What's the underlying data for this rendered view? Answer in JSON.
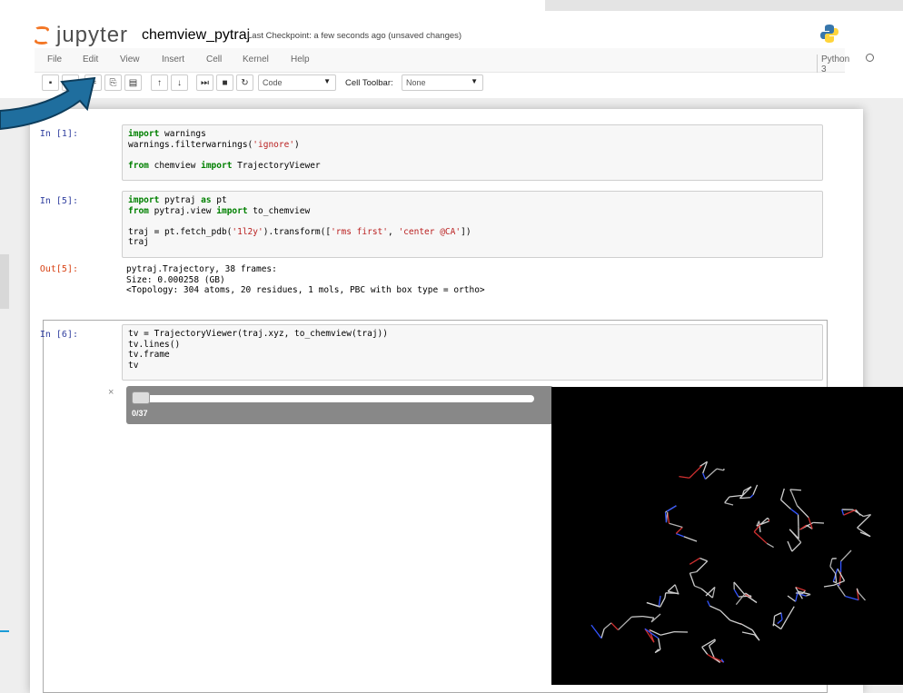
{
  "app": {
    "logo_text": "jupyter",
    "notebook_name": "chemview_pytraj",
    "checkpoint": "Last Checkpoint: a few seconds ago (unsaved changes)",
    "kernel_name": "Python 3"
  },
  "menu": [
    "File",
    "Edit",
    "View",
    "Insert",
    "Cell",
    "Kernel",
    "Help"
  ],
  "toolbar": {
    "cell_type": "Code",
    "cell_toolbar_label": "Cell Toolbar:",
    "cell_toolbar_value": "None",
    "buttons": [
      "save-icon",
      "add-icon",
      "cut-icon",
      "copy-icon",
      "paste-icon",
      "move-up-icon",
      "move-down-icon",
      "run-icon",
      "stop-icon",
      "restart-icon"
    ]
  },
  "cells": [
    {
      "prompt": "In [1]:",
      "lines": [
        [
          {
            "t": "import",
            "k": "kw"
          },
          {
            "t": " warnings"
          }
        ],
        [
          {
            "t": "warnings.filterwarnings("
          },
          {
            "t": "'ignore'",
            "k": "st"
          },
          {
            "t": ")"
          }
        ],
        [
          {
            "t": ""
          }
        ],
        [
          {
            "t": "from",
            "k": "kw"
          },
          {
            "t": " chemview "
          },
          {
            "t": "import",
            "k": "kw"
          },
          {
            "t": " TrajectoryViewer"
          }
        ]
      ]
    },
    {
      "prompt": "In [5]:",
      "lines": [
        [
          {
            "t": "import",
            "k": "kw"
          },
          {
            "t": " pytraj "
          },
          {
            "t": "as",
            "k": "kw"
          },
          {
            "t": " pt"
          }
        ],
        [
          {
            "t": "from",
            "k": "kw"
          },
          {
            "t": " pytraj.view "
          },
          {
            "t": "import",
            "k": "kw"
          },
          {
            "t": " to_chemview"
          }
        ],
        [
          {
            "t": ""
          }
        ],
        [
          {
            "t": "traj = pt.fetch_pdb("
          },
          {
            "t": "'1l2y'",
            "k": "st"
          },
          {
            "t": ").transform(["
          },
          {
            "t": "'rms first'",
            "k": "st"
          },
          {
            "t": ", "
          },
          {
            "t": "'center @CA'",
            "k": "st"
          },
          {
            "t": "])"
          }
        ],
        [
          {
            "t": "traj"
          }
        ]
      ],
      "output_prompt": "Out[5]:",
      "output": "pytraj.Trajectory, 38 frames:\nSize: 0.000258 (GB)\n<Topology: 304 atoms, 20 residues, 1 mols, PBC with box type = ortho>"
    },
    {
      "prompt": "In [6]:",
      "lines": [
        [
          {
            "t": "tv = TrajectoryViewer(traj.xyz, to_chemview(traj))"
          }
        ],
        [
          {
            "t": "tv.lines()"
          }
        ],
        [
          {
            "t": "tv.frame"
          }
        ],
        [
          {
            "t": "tv"
          }
        ]
      ]
    }
  ],
  "widget": {
    "close_glyph": "×",
    "frame_label": "0/37",
    "slider_value": 0,
    "slider_max": 37
  },
  "colors": {
    "arrow": "#1f6e9e",
    "keyword": "#008000",
    "string": "#ba2121",
    "in_prompt": "#303f9f",
    "out_prompt": "#d84315",
    "viewer_bg": "#000000"
  }
}
